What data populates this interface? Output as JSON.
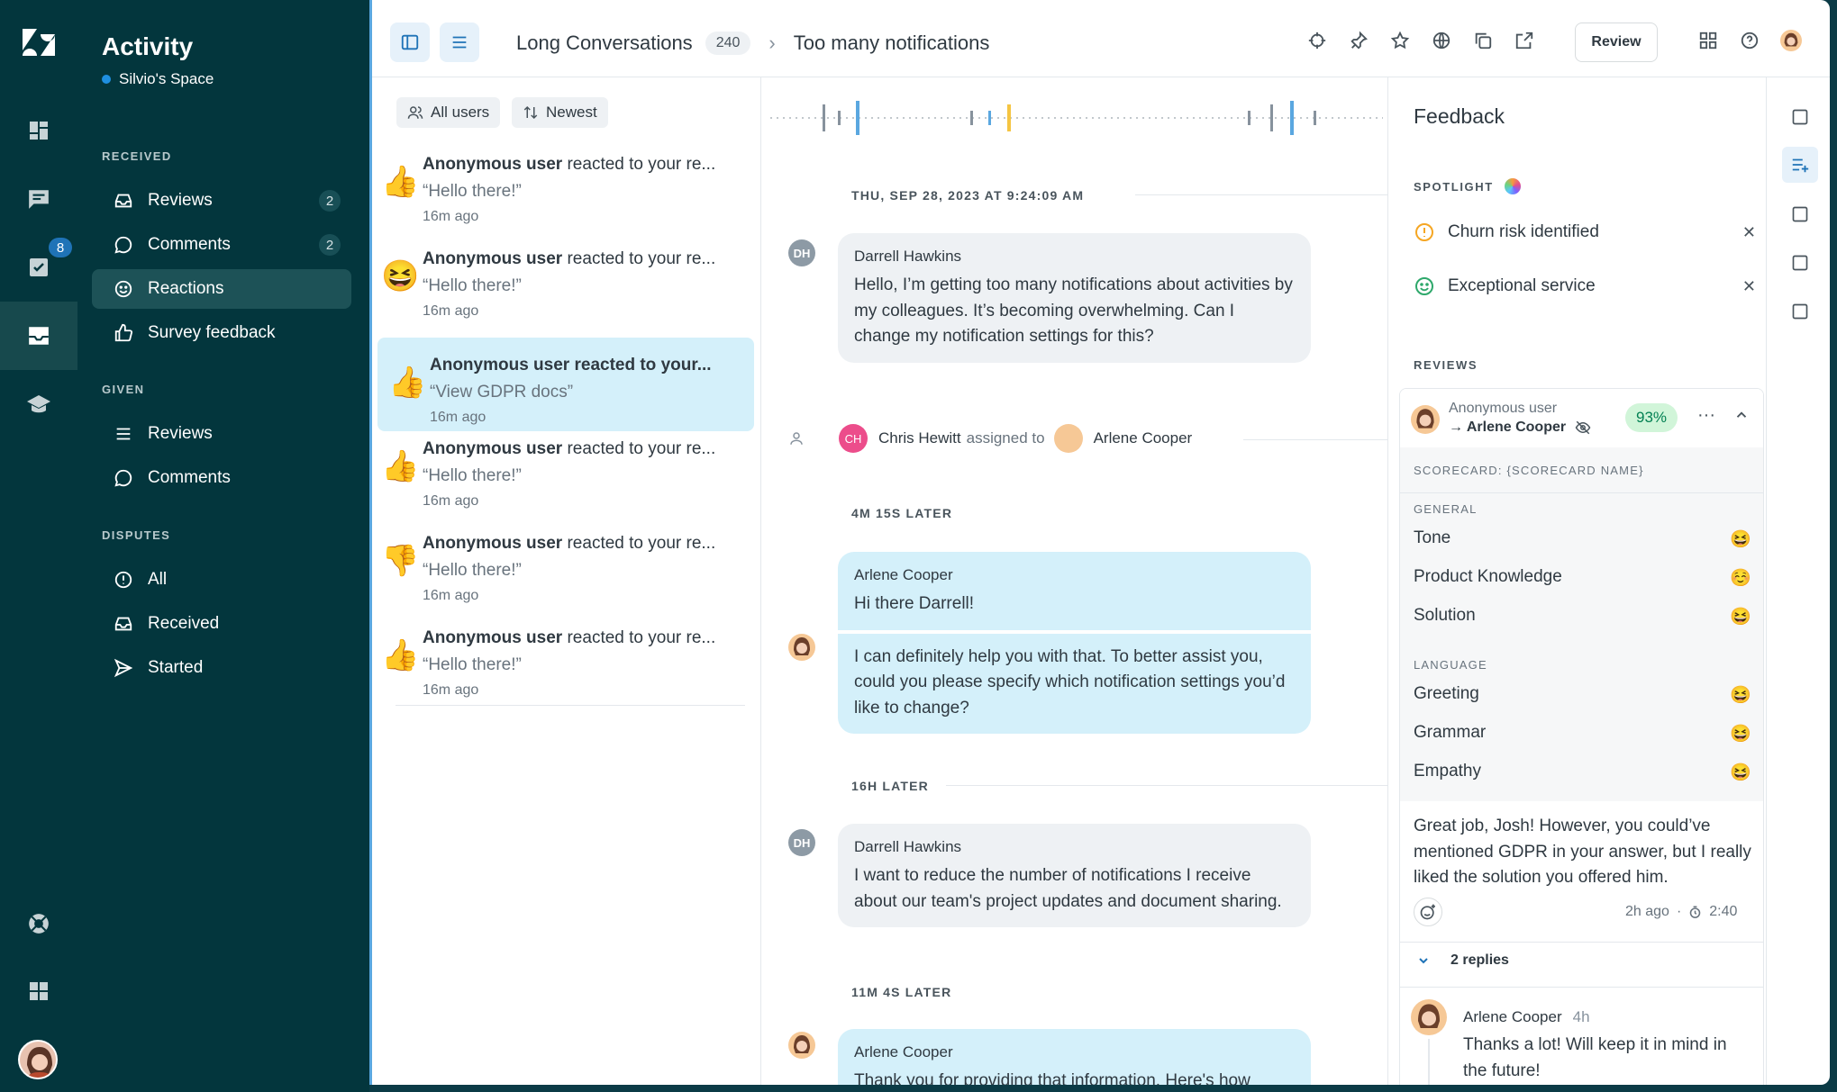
{
  "rail": {
    "badge": "8"
  },
  "nav": {
    "title": "Activity",
    "space": "Silvio's Space",
    "received_heading": "RECEIVED",
    "received": [
      {
        "label": "Reviews",
        "count": "2"
      },
      {
        "label": "Comments",
        "count": "2"
      },
      {
        "label": "Reactions",
        "count": ""
      },
      {
        "label": "Survey feedback",
        "count": ""
      }
    ],
    "given_heading": "GIVEN",
    "given": [
      {
        "label": "Reviews"
      },
      {
        "label": "Comments"
      }
    ],
    "disputes_heading": "DISPUTES",
    "disputes": [
      {
        "label": "All"
      },
      {
        "label": "Received"
      },
      {
        "label": "Started"
      }
    ]
  },
  "topbar": {
    "conversation": "Long Conversations",
    "count": "240",
    "title": "Too many notifications",
    "review_label": "Review"
  },
  "filters": {
    "users": "All users",
    "sort": "Newest"
  },
  "reactions": [
    {
      "user": "Anonymous user",
      "action": " reacted to your re...",
      "quote": "“Hello there!”",
      "time": "16m ago",
      "emoji": "👍"
    },
    {
      "user": "Anonymous user",
      "action": " reacted to your re...",
      "quote": "“Hello there!”",
      "time": "16m ago",
      "emoji": "😆"
    },
    {
      "user": "Anonymous user",
      "action": " reacted to your...",
      "quote": "“View GDPR docs”",
      "time": "16m ago",
      "emoji": "👍"
    },
    {
      "user": "Anonymous user",
      "action": " reacted to your re...",
      "quote": "“Hello there!”",
      "time": "16m ago",
      "emoji": "👍"
    },
    {
      "user": "Anonymous user",
      "action": " reacted to your re...",
      "quote": "“Hello there!”",
      "time": "16m ago",
      "emoji": "👎"
    },
    {
      "user": "Anonymous user",
      "action": " reacted to your re...",
      "quote": "“Hello there!”",
      "time": "16m ago",
      "emoji": "👍"
    }
  ],
  "conversation": {
    "date": "THU, SEP 28, 2023 AT 9:24:09 AM",
    "msg1": {
      "initials": "DH",
      "name": "Darrell Hawkins",
      "text": "Hello, I’m getting too many notifications about activities by my colleagues. It’s becoming overwhelming. Can I change my notification settings for this?"
    },
    "assign": {
      "initials": "CH",
      "from": "Chris Hewitt",
      "verb": "assigned to",
      "to": "Arlene Cooper"
    },
    "gap1": "4M 15S LATER",
    "msg2": {
      "name": "Arlene Cooper",
      "text1": "Hi there Darrell!",
      "text2": "I can definitely help you with that. To better assist you, could you please specify which notification settings you’d like to change?"
    },
    "gap2": "16H LATER",
    "msg3": {
      "initials": "DH",
      "name": "Darrell Hawkins",
      "text": "I want to reduce the number of notifications I receive about our team's project updates and document sharing."
    },
    "gap3": "11M 4S LATER",
    "msg4": {
      "name": "Arlene Cooper",
      "text": "Thank you for providing that information. Here's how"
    }
  },
  "feedback": {
    "title": "Feedback",
    "spotlight": "SPOTLIGHT",
    "spot_items": [
      {
        "label": "Churn risk identified",
        "color": "#f5a623"
      },
      {
        "label": "Exceptional service",
        "color": "#2ea86b"
      }
    ],
    "reviews_heading": "REVIEWS",
    "review": {
      "reviewer": "Anonymous user",
      "reviewee": "→ Arlene Cooper",
      "score": "93%",
      "scorecard": "SCORECARD: {SCORECARD NAME}",
      "general": "GENERAL",
      "general_items": [
        {
          "label": "Tone",
          "emoji": "😆"
        },
        {
          "label": "Product Knowledge",
          "emoji": "☺️"
        },
        {
          "label": "Solution",
          "emoji": "😆"
        }
      ],
      "language": "LANGUAGE",
      "language_items": [
        {
          "label": "Greeting",
          "emoji": "😆"
        },
        {
          "label": "Grammar",
          "emoji": "😆"
        },
        {
          "label": "Empathy",
          "emoji": "😆"
        }
      ],
      "comment": "Great job, Josh! However, you could’ve mentioned GDPR in your answer, but I really liked the solution you offered him.",
      "time": "2h ago",
      "duration": "2:40",
      "replies": "2 replies",
      "reply": {
        "name": "Arlene Cooper",
        "time": "4h",
        "text": "Thanks a lot! Will keep it in mind in the future!"
      }
    }
  }
}
